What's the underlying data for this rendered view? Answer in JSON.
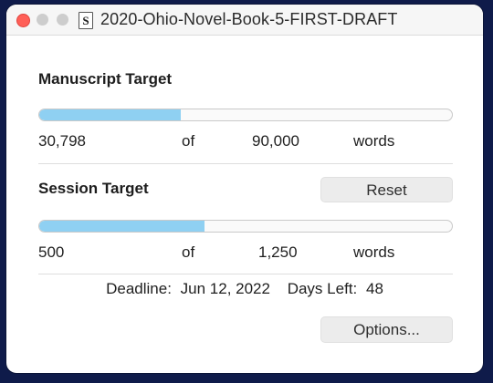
{
  "window": {
    "title": "2020-Ohio-Novel-Book-5-FIRST-DRAFT",
    "doc_icon_glyph": "S"
  },
  "manuscript": {
    "heading": "Manuscript Target",
    "current": "30,798",
    "of_label": "of",
    "target": "90,000",
    "unit": "words",
    "progress_fraction": 0.342
  },
  "session": {
    "heading": "Session Target",
    "reset_label": "Reset",
    "current": "500",
    "of_label": "of",
    "target": "1,250",
    "unit": "words",
    "progress_fraction": 0.4
  },
  "deadline": {
    "label": "Deadline:",
    "date": "Jun 12, 2022",
    "days_left_label": "Days Left:",
    "days_left": "48"
  },
  "options_label": "Options...",
  "colors": {
    "progress_fill": "#8fd0f2",
    "close_button": "#ff5f57",
    "background": "#0f1b4a"
  }
}
